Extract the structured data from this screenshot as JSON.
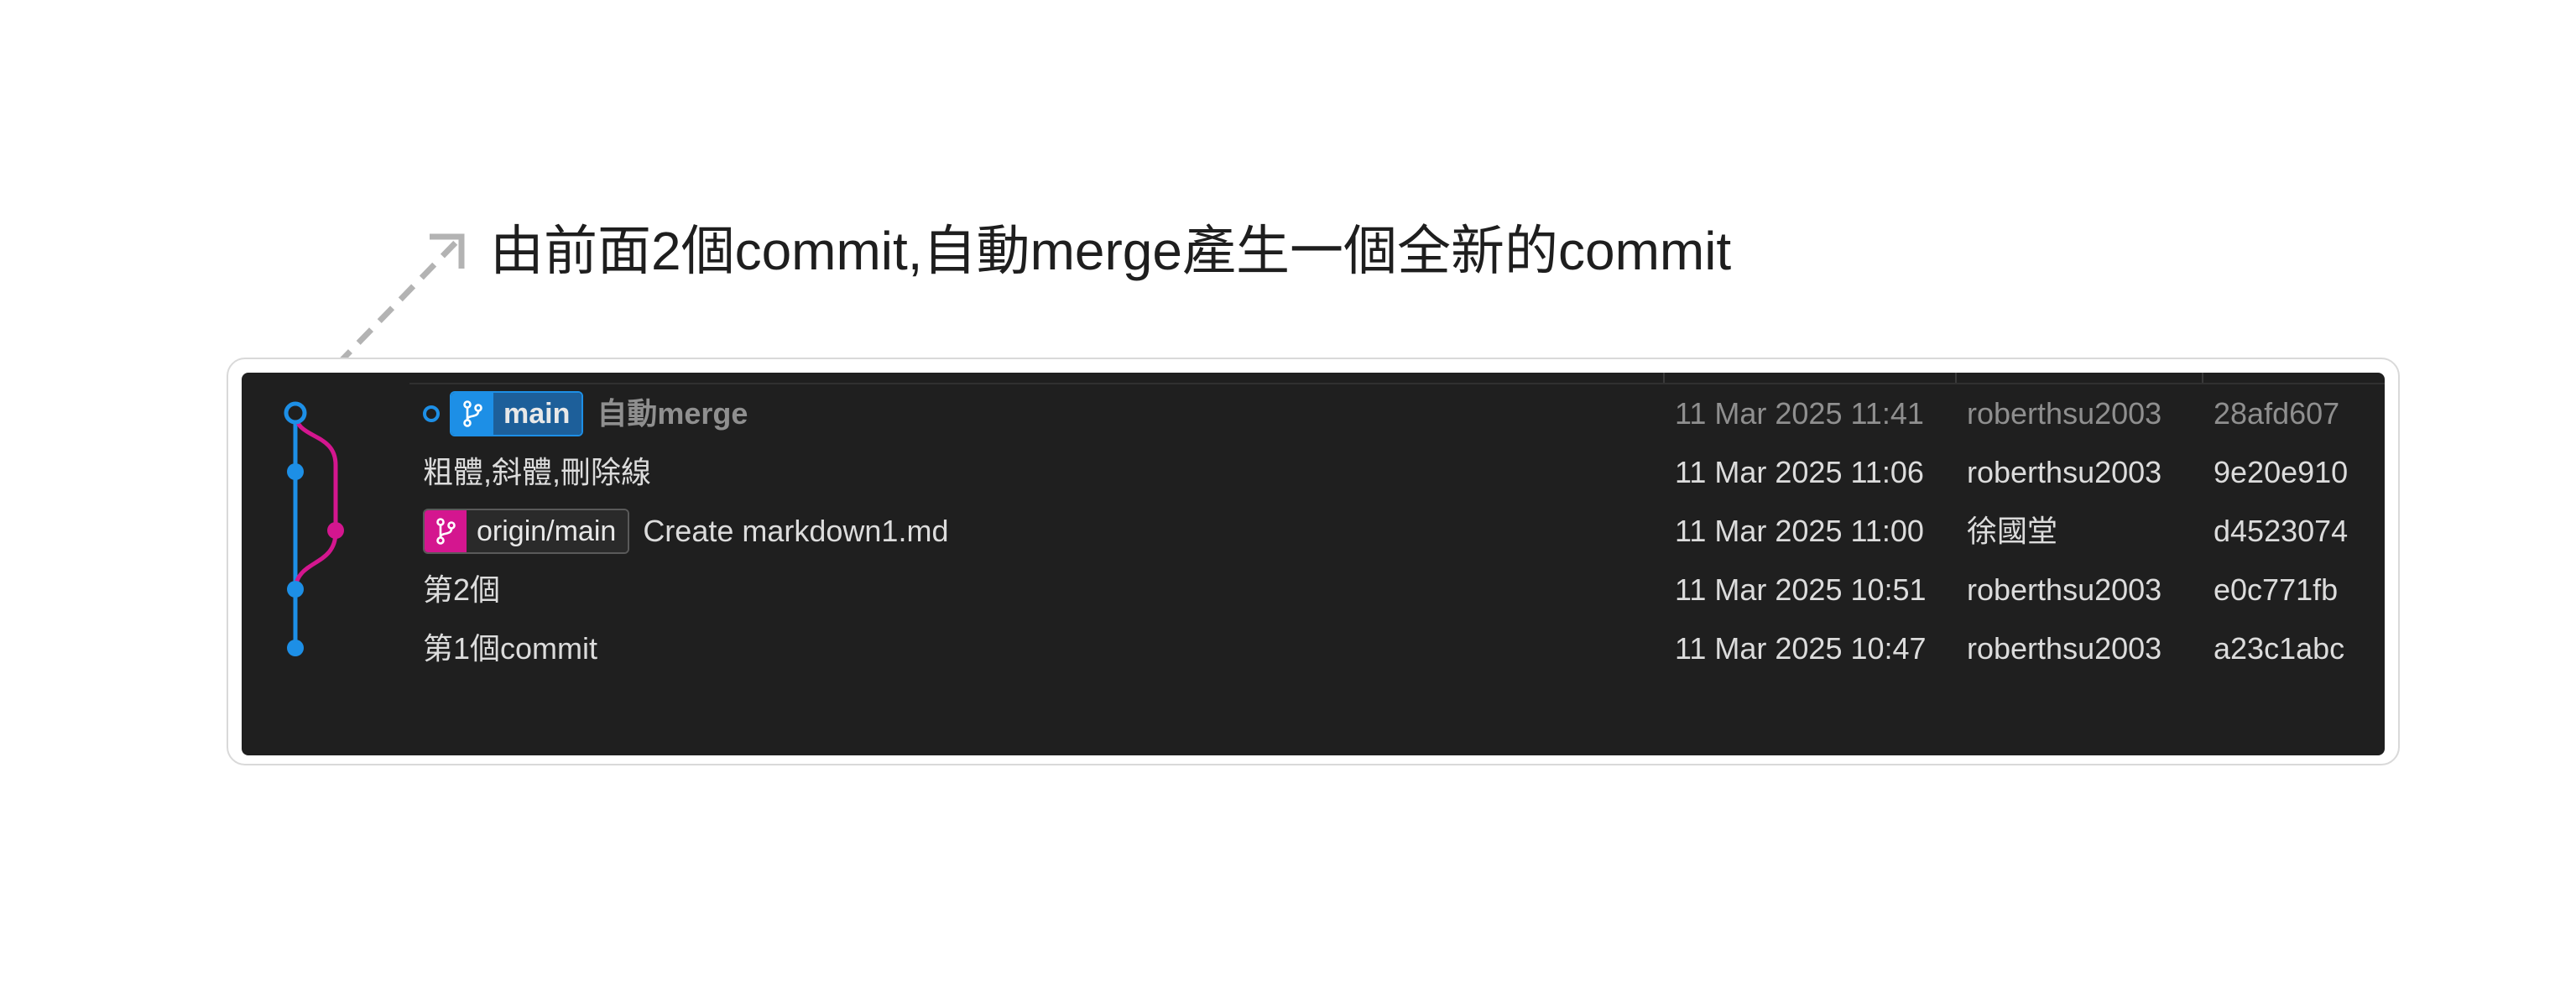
{
  "annotation": {
    "text": "由前面2個commit,自動merge產生一個全新的commit"
  },
  "colors": {
    "main_lane": "#1d8fe6",
    "remote_lane": "#d4168f",
    "panel_bg": "#1f1f1f",
    "arrow": "#b3b3b3"
  },
  "commits": [
    {
      "message": "自動merge",
      "date": "11 Mar 2025 11:41",
      "author": "roberthsu2003",
      "hash": "28afd607",
      "is_head": true,
      "branch": {
        "label": "main",
        "icon": "git-branch-icon"
      }
    },
    {
      "message": "粗體,斜體,刪除線",
      "date": "11 Mar 2025 11:06",
      "author": "roberthsu2003",
      "hash": "9e20e910"
    },
    {
      "message": "Create markdown1.md",
      "date": "11 Mar 2025 11:00",
      "author": "徐國堂",
      "hash": "d4523074",
      "branch": {
        "label": "origin/main",
        "icon": "git-branch-icon"
      }
    },
    {
      "message": "第2個",
      "date": "11 Mar 2025 10:51",
      "author": "roberthsu2003",
      "hash": "e0c771fb"
    },
    {
      "message": "第1個commit",
      "date": "11 Mar 2025 10:47",
      "author": "roberthsu2003",
      "hash": "a23c1abc"
    }
  ]
}
